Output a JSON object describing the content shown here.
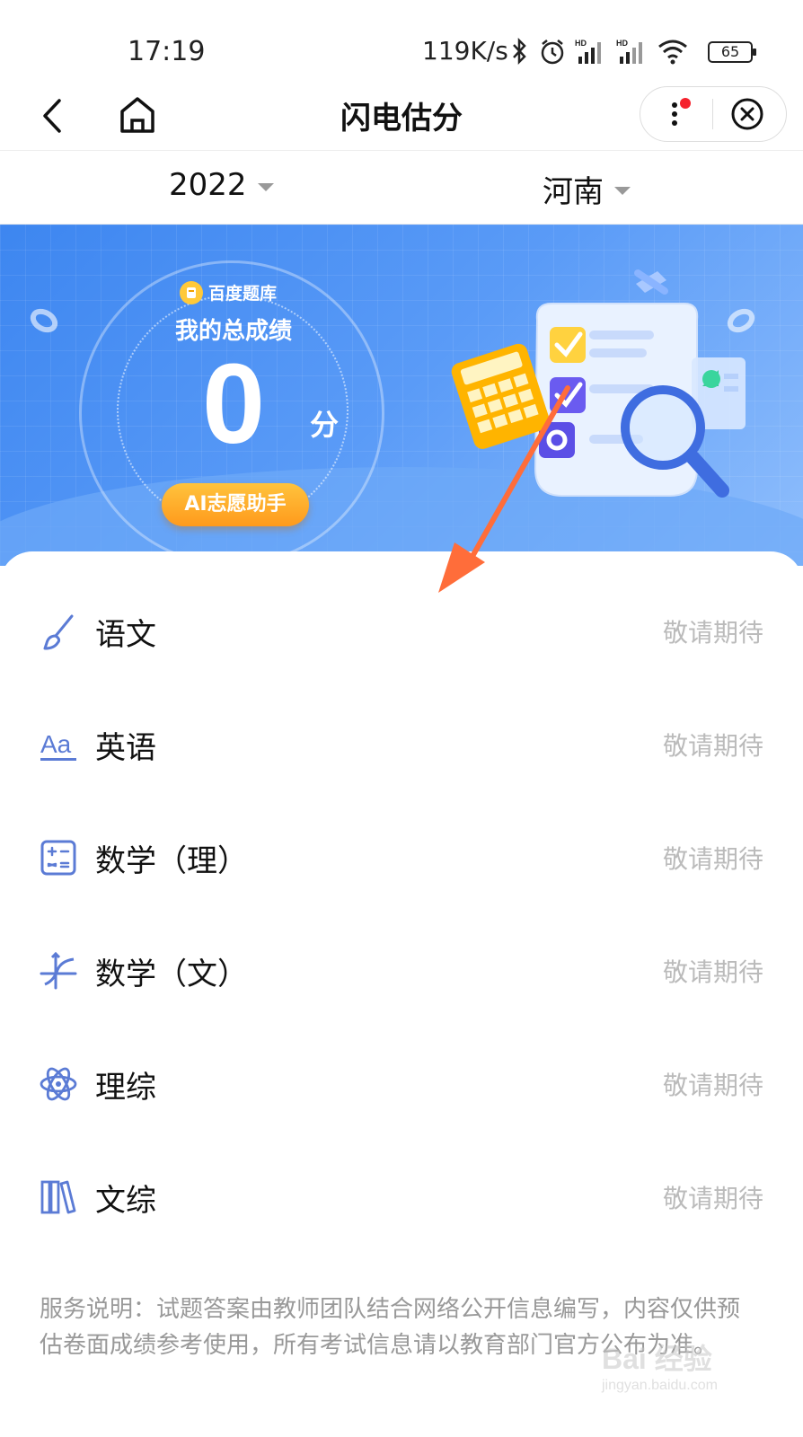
{
  "status_bar": {
    "time": "17:19",
    "net_speed": "119K/s",
    "battery": "65",
    "signal_label": "HD"
  },
  "nav": {
    "title": "闪电估分"
  },
  "filters": {
    "year": "2022",
    "province": "河南"
  },
  "banner": {
    "brand": "百度题库",
    "score_label": "我的总成绩",
    "score": "0",
    "score_unit": "分",
    "ai_button": "AI志愿助手"
  },
  "subjects": [
    {
      "name": "语文",
      "status": "敬请期待",
      "icon": "brush-icon"
    },
    {
      "name": "英语",
      "status": "敬请期待",
      "icon": "aa-icon"
    },
    {
      "name": "数学（理）",
      "status": "敬请期待",
      "icon": "calculator-icon"
    },
    {
      "name": "数学（文）",
      "status": "敬请期待",
      "icon": "function-graph-icon"
    },
    {
      "name": "理综",
      "status": "敬请期待",
      "icon": "atom-icon"
    },
    {
      "name": "文综",
      "status": "敬请期待",
      "icon": "books-icon"
    }
  ],
  "notice": "服务说明：试题答案由教师团队结合网络公开信息编写，内容仅供预估卷面成绩参考使用，所有考试信息请以教育部门官方公布为准。",
  "watermark": {
    "text": "Bai 经验",
    "url": "jingyan.baidu.com"
  },
  "colors": {
    "accent": "#3d86f0",
    "ai_button": "#ffa726",
    "arrow": "#ff6d3a",
    "icon": "#5b7bd5",
    "muted": "#bbbbbb"
  }
}
